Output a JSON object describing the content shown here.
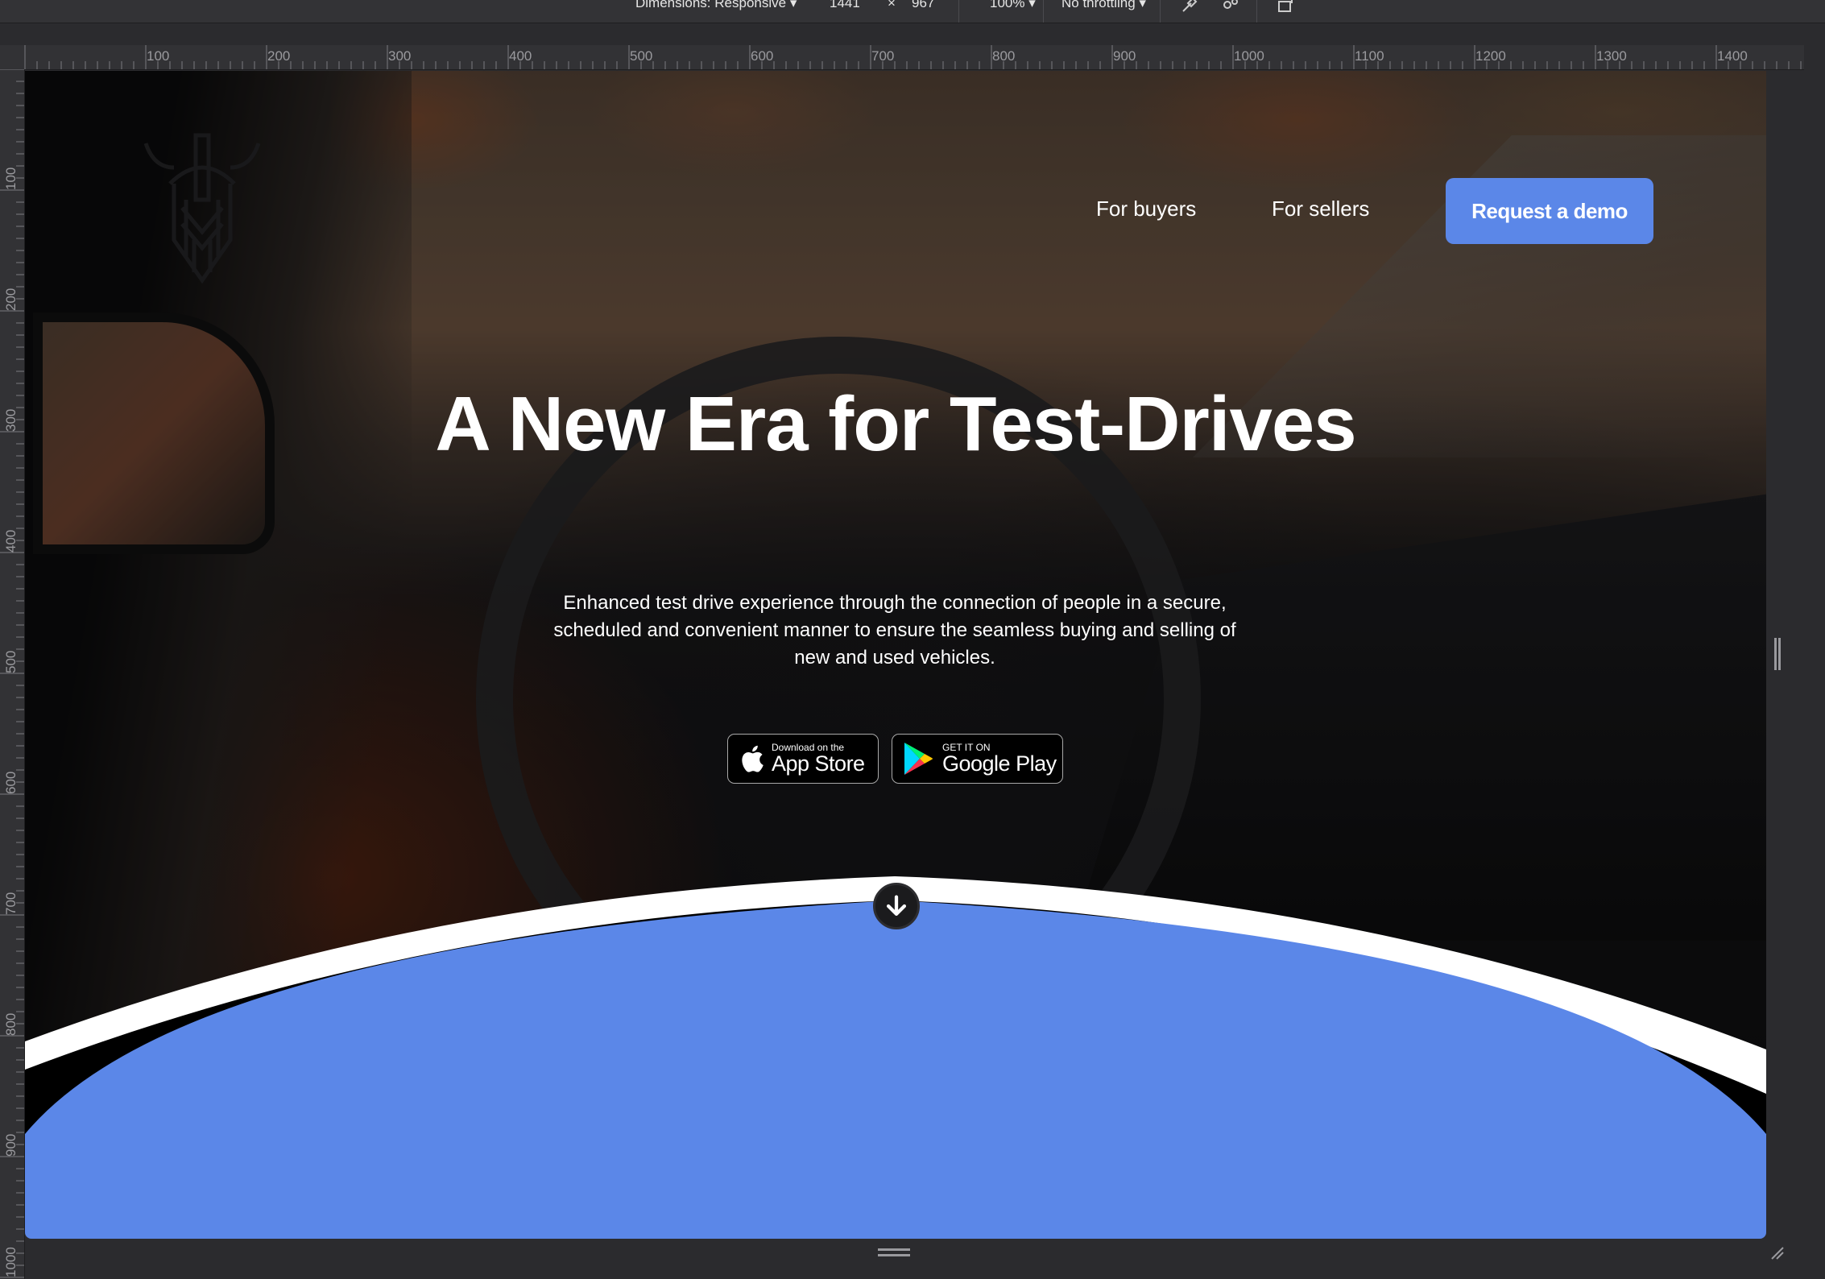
{
  "devtools": {
    "dimensions_label": "Dimensions: Responsive",
    "width": "1441",
    "times": "×",
    "height": "967",
    "zoom": "100%",
    "throttling": "No throttling",
    "ruler_top": [
      "100",
      "200",
      "300",
      "400",
      "500",
      "600",
      "700",
      "800",
      "900",
      "1000",
      "1100",
      "1200",
      "1300",
      "1400"
    ],
    "ruler_left": [
      "100",
      "200",
      "300",
      "400",
      "500",
      "600",
      "700",
      "800",
      "900",
      "1000"
    ]
  },
  "site": {
    "nav": {
      "buyers": "For buyers",
      "sellers": "For sellers",
      "demo": "Request a demo"
    },
    "hero": {
      "title": "A New Era for Test-Drives",
      "subtitle": "Enhanced test drive experience through the connection of people in a secure, scheduled and convenient manner to ensure the seamless buying and selling of new and used vehicles."
    },
    "app_store": {
      "small": "Download on the",
      "big": "App Store"
    },
    "google_play": {
      "small": "GET IT ON",
      "big": "Google Play"
    },
    "colors": {
      "accent": "#5b87e8",
      "wave": "#5b87e8"
    },
    "icons": [
      "apple-icon",
      "google-play-icon",
      "arrow-down-icon",
      "viking-logo"
    ]
  }
}
